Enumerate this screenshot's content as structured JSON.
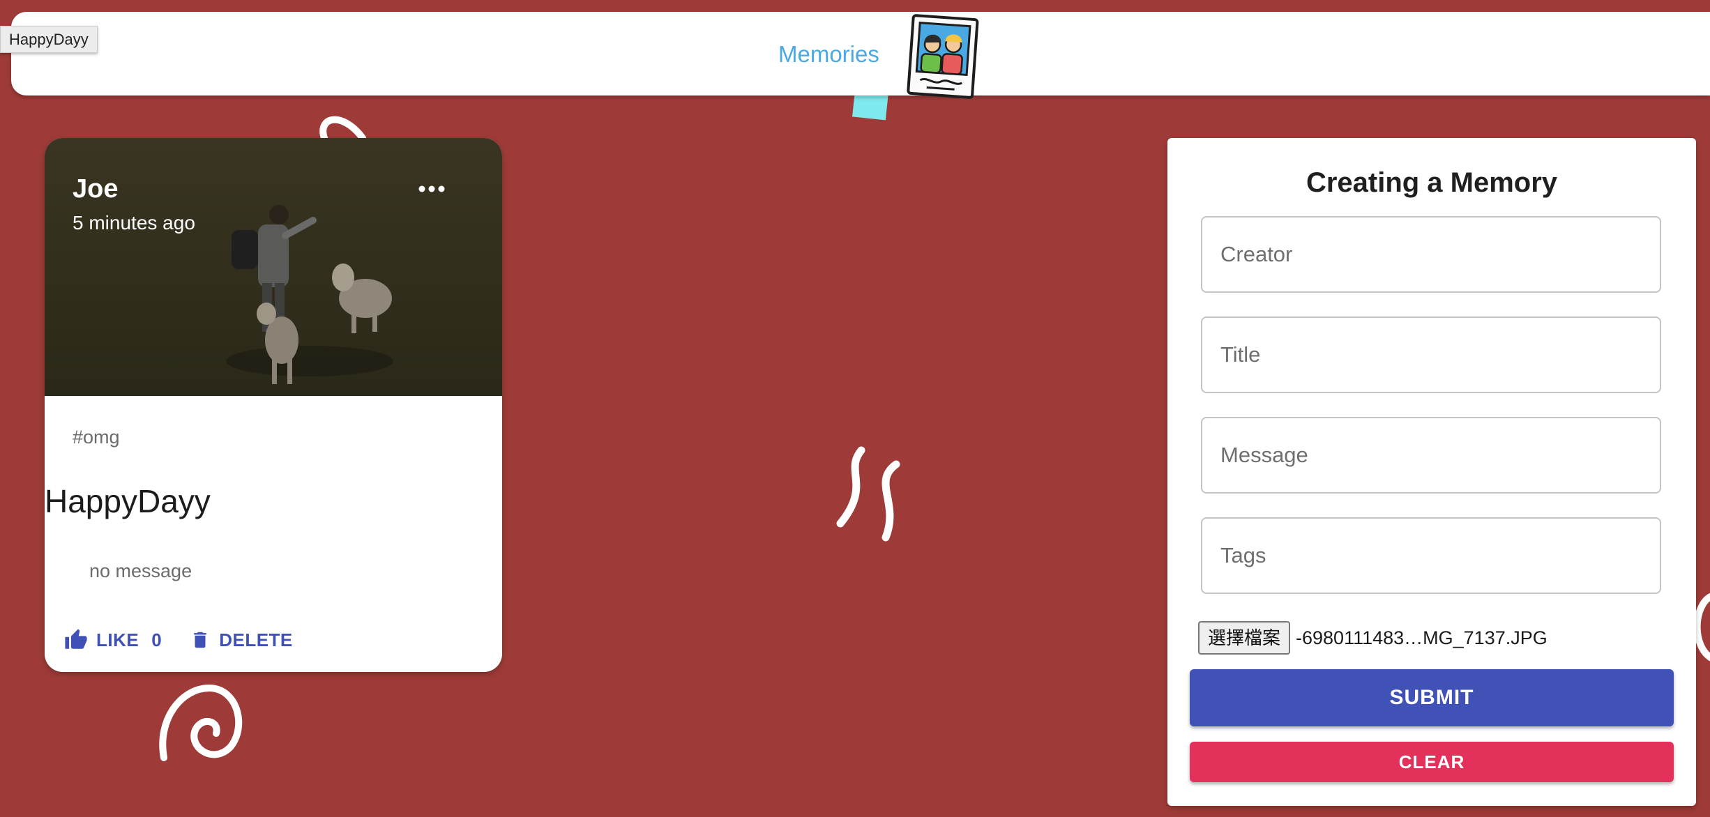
{
  "tooltip": {
    "text": "HappyDayy"
  },
  "appbar": {
    "title": "Memories"
  },
  "post": {
    "creator": "Joe",
    "time": "5 minutes ago",
    "tags": "#omg",
    "title": "HappyDayy",
    "message": "no message",
    "like_label": "LIKE",
    "like_count": "0",
    "delete_label": "DELETE"
  },
  "form": {
    "title": "Creating a Memory",
    "creator_placeholder": "Creator",
    "title_placeholder": "Title",
    "message_placeholder": "Message",
    "tags_placeholder": "Tags",
    "file_button": "選擇檔案",
    "file_name": "-6980111483…MG_7137.JPG",
    "submit_label": "SUBMIT",
    "clear_label": "CLEAR"
  },
  "colors": {
    "background": "#9e3b38",
    "primary": "#4052b5",
    "secondary": "#e3315b",
    "title_accent": "#4aa9e3"
  }
}
